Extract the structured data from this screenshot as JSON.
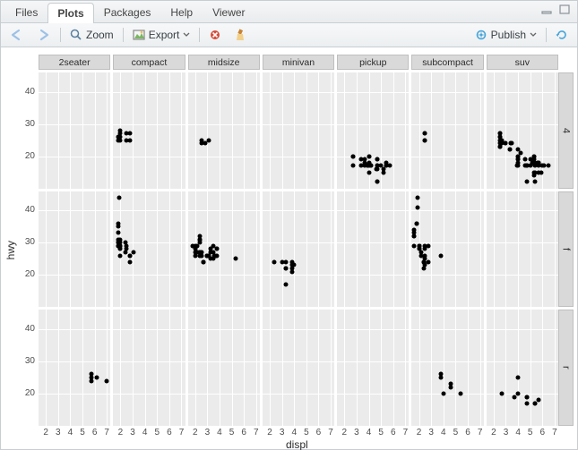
{
  "tabs": {
    "items": [
      "Files",
      "Plots",
      "Packages",
      "Help",
      "Viewer"
    ],
    "active": 1
  },
  "toolbar": {
    "zoom": "Zoom",
    "export": "Export",
    "publish": "Publish"
  },
  "chart_data": {
    "type": "scatter",
    "xlabel": "displ",
    "ylabel": "hwy",
    "x_ticks": [
      2,
      3,
      4,
      5,
      6,
      7
    ],
    "y_ticks": [
      20,
      30,
      40
    ],
    "xlim": [
      1.4,
      7.3
    ],
    "ylim": [
      10,
      46
    ],
    "facet_cols": [
      "2seater",
      "compact",
      "midsize",
      "minivan",
      "pickup",
      "subcompact",
      "suv"
    ],
    "facet_rows": [
      "4",
      "f",
      "r"
    ],
    "panels": {
      "2seater": {
        "4": [],
        "f": [],
        "r": [
          [
            5.7,
            26
          ],
          [
            5.7,
            24
          ],
          [
            5.7,
            25
          ],
          [
            6.2,
            25
          ],
          [
            7.0,
            24
          ]
        ]
      },
      "compact": {
        "4": [
          [
            1.8,
            26
          ],
          [
            1.8,
            25
          ],
          [
            2.0,
            28
          ],
          [
            2.0,
            27
          ],
          [
            2.0,
            26
          ],
          [
            2.0,
            25
          ],
          [
            2.5,
            27
          ],
          [
            2.5,
            25
          ],
          [
            2.8,
            25
          ],
          [
            2.8,
            27
          ]
        ],
        "f": [
          [
            1.8,
            29
          ],
          [
            1.8,
            29
          ],
          [
            2.0,
            31
          ],
          [
            2.0,
            30
          ],
          [
            2.8,
            26
          ],
          [
            2.8,
            26
          ],
          [
            3.1,
            27
          ],
          [
            1.8,
            30
          ],
          [
            1.8,
            33
          ],
          [
            2.0,
            29
          ],
          [
            2.0,
            29
          ],
          [
            2.0,
            28
          ],
          [
            2.0,
            29
          ],
          [
            2.8,
            24
          ],
          [
            1.9,
            44
          ],
          [
            2.0,
            26
          ],
          [
            2.0,
            29
          ],
          [
            2.4,
            27
          ],
          [
            2.4,
            30
          ],
          [
            2.5,
            28
          ],
          [
            2.5,
            29
          ],
          [
            1.8,
            36
          ],
          [
            1.8,
            35
          ],
          [
            1.8,
            31
          ],
          [
            1.8,
            30
          ],
          [
            2.0,
            28
          ],
          [
            2.0,
            29
          ]
        ],
        "r": []
      },
      "midsize": {
        "4": [
          [
            2.8,
            24
          ],
          [
            3.1,
            25
          ],
          [
            2.5,
            25
          ],
          [
            2.5,
            24
          ]
        ],
        "f": [
          [
            2.4,
            27
          ],
          [
            2.4,
            30
          ],
          [
            3.1,
            26
          ],
          [
            3.5,
            29
          ],
          [
            3.6,
            26
          ],
          [
            2.4,
            26
          ],
          [
            2.4,
            27
          ],
          [
            3.3,
            28
          ],
          [
            2.0,
            26
          ],
          [
            2.0,
            28
          ],
          [
            2.0,
            27
          ],
          [
            2.0,
            29
          ],
          [
            2.7,
            24
          ],
          [
            2.7,
            24
          ],
          [
            2.7,
            24
          ],
          [
            3.0,
            26
          ],
          [
            3.7,
            26
          ],
          [
            2.4,
            31
          ],
          [
            2.4,
            32
          ],
          [
            2.5,
            26
          ],
          [
            2.5,
            27
          ],
          [
            3.5,
            25
          ],
          [
            3.0,
            26
          ],
          [
            3.3,
            25
          ],
          [
            3.3,
            27
          ],
          [
            3.8,
            26
          ],
          [
            3.8,
            28
          ],
          [
            3.8,
            28
          ],
          [
            5.3,
            25
          ],
          [
            2.2,
            27
          ],
          [
            2.2,
            29
          ],
          [
            2.4,
            31
          ],
          [
            2.4,
            31
          ],
          [
            3.0,
            26
          ],
          [
            3.0,
            26
          ],
          [
            3.5,
            27
          ],
          [
            1.8,
            29
          ],
          [
            2.2,
            27
          ],
          [
            2.4,
            31
          ]
        ],
        "r": []
      },
      "minivan": {
        "4": [],
        "f": [
          [
            2.4,
            24
          ],
          [
            3.0,
            24
          ],
          [
            3.3,
            22
          ],
          [
            3.3,
            22
          ],
          [
            3.3,
            24
          ],
          [
            3.8,
            24
          ],
          [
            3.8,
            22
          ],
          [
            3.8,
            21
          ],
          [
            3.8,
            23
          ],
          [
            4.0,
            23
          ],
          [
            3.3,
            17
          ]
        ],
        "r": []
      },
      "pickup": {
        "4": [
          [
            2.7,
            20
          ],
          [
            2.7,
            17
          ],
          [
            2.7,
            20
          ],
          [
            3.4,
            17
          ],
          [
            3.4,
            19
          ],
          [
            4.0,
            20
          ],
          [
            3.7,
            19
          ],
          [
            3.7,
            18
          ],
          [
            3.7,
            17
          ],
          [
            3.9,
            17
          ],
          [
            3.9,
            17
          ],
          [
            4.7,
            19
          ],
          [
            4.7,
            19
          ],
          [
            4.7,
            12
          ],
          [
            4.7,
            17
          ],
          [
            4.7,
            16
          ],
          [
            4.7,
            12
          ],
          [
            4.7,
            17
          ],
          [
            5.2,
            15
          ],
          [
            5.2,
            16
          ],
          [
            5.7,
            17
          ],
          [
            4.0,
            17
          ],
          [
            4.0,
            17
          ],
          [
            4.6,
            16
          ],
          [
            5.0,
            17
          ],
          [
            5.4,
            17
          ],
          [
            5.4,
            17
          ],
          [
            5.4,
            18
          ],
          [
            4.0,
            15
          ],
          [
            4.0,
            18
          ],
          [
            4.0,
            20
          ],
          [
            4.2,
            17
          ],
          [
            4.2,
            17
          ]
        ],
        "f": [],
        "r": []
      },
      "subcompact": {
        "4": [
          [
            2.5,
            27
          ],
          [
            2.5,
            25
          ],
          [
            2.5,
            27
          ],
          [
            2.5,
            25
          ]
        ],
        "f": [
          [
            3.8,
            26
          ],
          [
            2.0,
            29
          ],
          [
            2.0,
            28
          ],
          [
            2.0,
            28
          ],
          [
            2.0,
            29
          ],
          [
            1.6,
            33
          ],
          [
            1.6,
            32
          ],
          [
            1.6,
            32
          ],
          [
            1.6,
            29
          ],
          [
            1.6,
            34
          ],
          [
            1.8,
            36
          ],
          [
            1.8,
            36
          ],
          [
            2.0,
            29
          ],
          [
            2.4,
            24
          ],
          [
            2.4,
            24
          ],
          [
            2.4,
            24
          ],
          [
            2.4,
            22
          ],
          [
            2.5,
            26
          ],
          [
            2.5,
            23
          ],
          [
            2.2,
            26
          ],
          [
            2.2,
            27
          ],
          [
            2.5,
            28
          ],
          [
            2.5,
            25
          ],
          [
            2.8,
            24
          ],
          [
            2.8,
            29
          ],
          [
            1.9,
            44
          ],
          [
            1.9,
            41
          ],
          [
            2.0,
            29
          ],
          [
            2.5,
            29
          ]
        ],
        "r": [
          [
            3.8,
            26
          ],
          [
            3.8,
            25
          ],
          [
            4.0,
            20
          ],
          [
            4.6,
            23
          ],
          [
            4.6,
            22
          ],
          [
            5.4,
            20
          ]
        ]
      },
      "suv": {
        "4": [
          [
            5.3,
            20
          ],
          [
            5.3,
            15
          ],
          [
            5.3,
            20
          ],
          [
            5.7,
            17
          ],
          [
            6.0,
            17
          ],
          [
            5.3,
            19
          ],
          [
            5.3,
            14
          ],
          [
            5.7,
            15
          ],
          [
            6.5,
            17
          ],
          [
            3.9,
            17
          ],
          [
            4.7,
            17
          ],
          [
            4.7,
            12
          ],
          [
            4.7,
            17
          ],
          [
            5.2,
            18
          ],
          [
            5.7,
            18
          ],
          [
            5.9,
            15
          ],
          [
            4.0,
            19
          ],
          [
            4.0,
            19
          ],
          [
            4.6,
            19
          ],
          [
            5.0,
            17
          ],
          [
            5.4,
            12
          ],
          [
            5.4,
            18
          ],
          [
            5.4,
            15
          ],
          [
            5.4,
            17
          ],
          [
            4.0,
            17
          ],
          [
            4.0,
            22
          ],
          [
            4.6,
            17
          ],
          [
            5.0,
            19
          ],
          [
            3.0,
            24
          ],
          [
            3.0,
            24
          ],
          [
            3.5,
            24
          ],
          [
            3.3,
            22
          ],
          [
            3.3,
            22
          ],
          [
            4.0,
            20
          ],
          [
            5.6,
            18
          ],
          [
            2.5,
            23
          ],
          [
            2.5,
            23
          ],
          [
            2.5,
            23
          ],
          [
            2.5,
            24
          ],
          [
            2.5,
            26
          ],
          [
            2.5,
            26
          ],
          [
            2.5,
            27
          ],
          [
            2.5,
            25
          ],
          [
            2.5,
            27
          ],
          [
            2.7,
            25
          ],
          [
            2.7,
            24
          ],
          [
            3.4,
            24
          ],
          [
            3.4,
            24
          ],
          [
            4.0,
            20
          ],
          [
            4.7,
            17
          ],
          [
            4.7,
            17
          ],
          [
            4.7,
            17
          ],
          [
            5.7,
            18
          ],
          [
            6.1,
            17
          ],
          [
            4.0,
            18
          ],
          [
            4.2,
            21
          ]
        ],
        "f": [],
        "r": [
          [
            5.4,
            17
          ],
          [
            5.4,
            17
          ],
          [
            4.0,
            25
          ],
          [
            3.7,
            19
          ],
          [
            4.0,
            20
          ],
          [
            4.7,
            17
          ],
          [
            4.7,
            19
          ],
          [
            4.7,
            19
          ],
          [
            5.7,
            18
          ],
          [
            2.7,
            20
          ]
        ]
      }
    }
  }
}
